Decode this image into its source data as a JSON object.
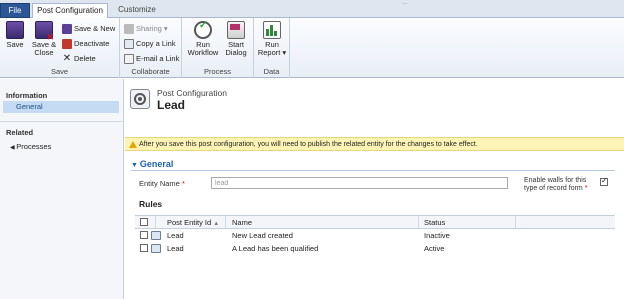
{
  "window": {
    "title_fragment": "..."
  },
  "tabs": {
    "file": "File",
    "post_configuration": "Post Configuration",
    "customize": "Customize"
  },
  "ribbon": {
    "save_group": {
      "label": "Save",
      "save": "Save",
      "save_close_1": "Save &",
      "save_close_2": "Close",
      "save_new": "Save & New",
      "deactivate": "Deactivate",
      "delete": "Delete"
    },
    "collaborate_group": {
      "label": "Collaborate",
      "sharing": "Sharing ▾",
      "copy_link": "Copy a Link",
      "email_link": "E-mail a Link"
    },
    "process_group": {
      "label": "Process",
      "run_workflow_1": "Run",
      "run_workflow_2": "Workflow",
      "start_dialog_1": "Start",
      "start_dialog_2": "Dialog"
    },
    "data_group": {
      "label": "Data",
      "run_report_1": "Run",
      "run_report_2": "Report ▾"
    }
  },
  "leftnav": {
    "information": "Information",
    "general": "General",
    "related": "Related",
    "processes": "Processes"
  },
  "header": {
    "entity_type": "Post Configuration",
    "record_name": "Lead"
  },
  "warning": "After you save this post configuration, you will need to publish the related entity for the changes to take effect.",
  "general_section": {
    "title": "General",
    "entity_name_label": "Entity Name",
    "entity_name_value": "lead",
    "enable_walls_label": "Enable walls for this type of record form",
    "enable_walls_checked": true
  },
  "rules": {
    "label": "Rules",
    "columns": [
      "Post Entity Id",
      "Name",
      "Status"
    ],
    "rows": [
      {
        "entity": "Lead",
        "name": "New Lead created",
        "status": "Inactive"
      },
      {
        "entity": "Lead",
        "name": "A Lead has been qualified",
        "status": "Active"
      }
    ]
  },
  "colors": {
    "file_tab": "#2b5797",
    "accent_blue": "#1c63b0",
    "warning_bg": "#fff4b6",
    "selected_nav": "#c5dbf3"
  },
  "icons": [
    "save-icon",
    "save-close-icon",
    "save-new-icon",
    "deactivate-icon",
    "delete-icon",
    "sharing-icon",
    "copy-link-icon",
    "email-link-icon",
    "run-workflow-icon",
    "start-dialog-icon",
    "run-report-icon",
    "warning-icon",
    "entity-icon",
    "sort-ascending-icon"
  ]
}
